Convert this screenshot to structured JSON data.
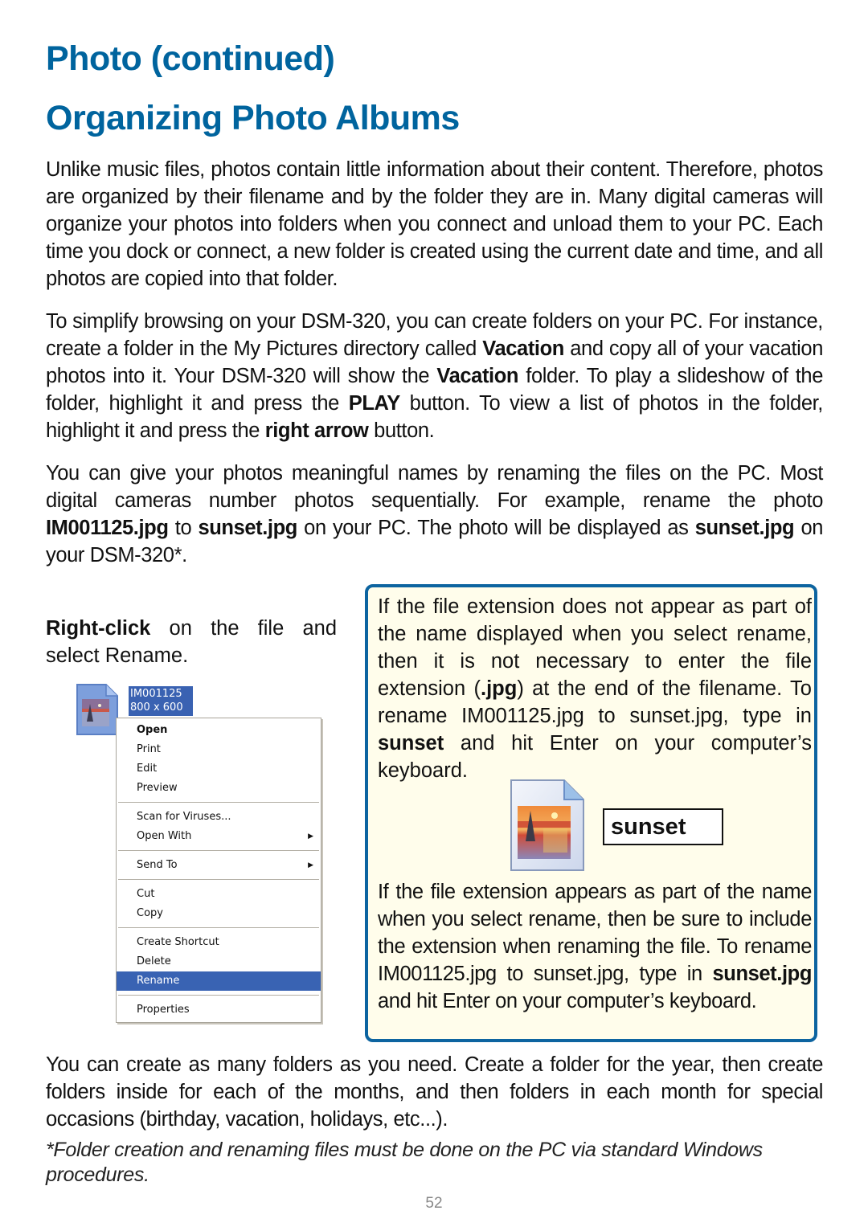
{
  "header": {
    "title": "Photo (continued)",
    "subtitle": "Organizing Photo Albums"
  },
  "paragraphs": {
    "p1": "Unlike music files, photos contain little information about their content. Therefore, photos are organized by their filename and by the folder they are in. Many digital cameras will organize your photos into folders when you connect and unload them to your PC. Each time you dock or connect, a new folder is created using the current date and time, and all photos are copied into that folder.",
    "p2": {
      "t1": "To simplify browsing on your DSM-320, you can create folders on your PC. For instance, create a folder in the My Pictures directory called ",
      "b1": "Vacation",
      "t2": " and copy all of your vacation photos into it. Your DSM-320 will show the ",
      "b2": "Vacation",
      "t3": " folder. To play a slideshow of the folder, highlight it and press the ",
      "b3": "PLAY",
      "t4": " button. To view a list of photos in the folder, highlight it and press the ",
      "b4": "right arrow",
      "t5": " button."
    },
    "p3": {
      "t1": "You can give your photos meaningful names by renaming the files on the PC. Most digital cameras number photos sequentially. For example, rename the photo ",
      "b1": "IM001125.jpg",
      "t2": " to ",
      "b2": "sunset.jpg",
      "t3": " on your PC. The photo will be displayed as ",
      "b3": "sunset.jpg",
      "t4": " on your DSM-320*."
    },
    "p4": "You can create as many folders as you need. Create a folder for the year, then create folders inside for each of the months, and then folders in each month for special occasions (birthday, vacation, holidays, etc...).",
    "footnote": "*Folder creation and renaming files must be done on the PC via standard Windows procedures."
  },
  "instruction": {
    "bold": "Right-click",
    "rest": " on the file and select Rename."
  },
  "explorer": {
    "file_name": "IM001125",
    "file_dims": "800 x 600",
    "icon": "image-file-icon"
  },
  "context_menu": {
    "groups": [
      [
        {
          "label": "Open",
          "bold": true
        },
        {
          "label": "Print"
        },
        {
          "label": "Edit"
        },
        {
          "label": "Preview"
        }
      ],
      [
        {
          "label": "Scan for Viruses..."
        },
        {
          "label": "Open With",
          "submenu": true
        }
      ],
      [
        {
          "label": "Send To",
          "submenu": true
        }
      ],
      [
        {
          "label": "Cut"
        },
        {
          "label": "Copy"
        }
      ],
      [
        {
          "label": "Create Shortcut"
        },
        {
          "label": "Delete"
        },
        {
          "label": "Rename",
          "selected": true
        }
      ],
      [
        {
          "label": "Properties"
        }
      ]
    ]
  },
  "tip_box": {
    "tip1": {
      "t1": "If the file extension does not appear as part of the name displayed when you select rename, then it is not necessary to enter the file extension (",
      "b1": ".jpg",
      "t2": ") at the end of the filename. To rename IM001125.jpg to sunset.jpg, type in ",
      "b2": "sunset",
      "t3": " and hit Enter on your computer’s keyboard."
    },
    "rename_value": "sunset",
    "tip2": {
      "t1": "If the file extension appears as part of the name when you select rename, then be sure to include the extension when renaming the file. To rename IM001125.jpg to sunset.jpg, type in ",
      "b1": "sunset.jpg",
      "t2": " and hit Enter on your computer’s keyboard."
    }
  },
  "colors": {
    "heading": "#00649e",
    "tip_border": "#0d64a0",
    "tip_background": "#fffdeb",
    "selection": "#3963b3"
  },
  "page_number": "52"
}
